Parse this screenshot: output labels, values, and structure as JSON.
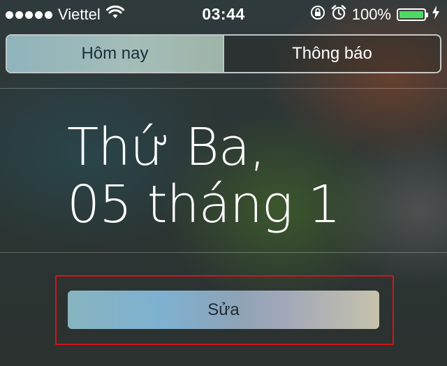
{
  "status_bar": {
    "carrier": "Viettel",
    "time": "03:44",
    "battery_percent_label": "100%",
    "battery_level": 1.0,
    "icons": [
      "signal-dots-icon",
      "wifi-icon",
      "rotation-lock-icon",
      "alarm-icon",
      "battery-icon",
      "charging-icon"
    ]
  },
  "tabs": [
    {
      "label": "Hôm nay",
      "selected": true
    },
    {
      "label": "Thông báo",
      "selected": false
    }
  ],
  "date": {
    "weekday": "Thứ Ba,",
    "day_month": "05 tháng 1"
  },
  "edit_button": {
    "label": "Sửa"
  },
  "colors": {
    "highlight": "#d4141a",
    "battery_fill": "#4cd964"
  }
}
